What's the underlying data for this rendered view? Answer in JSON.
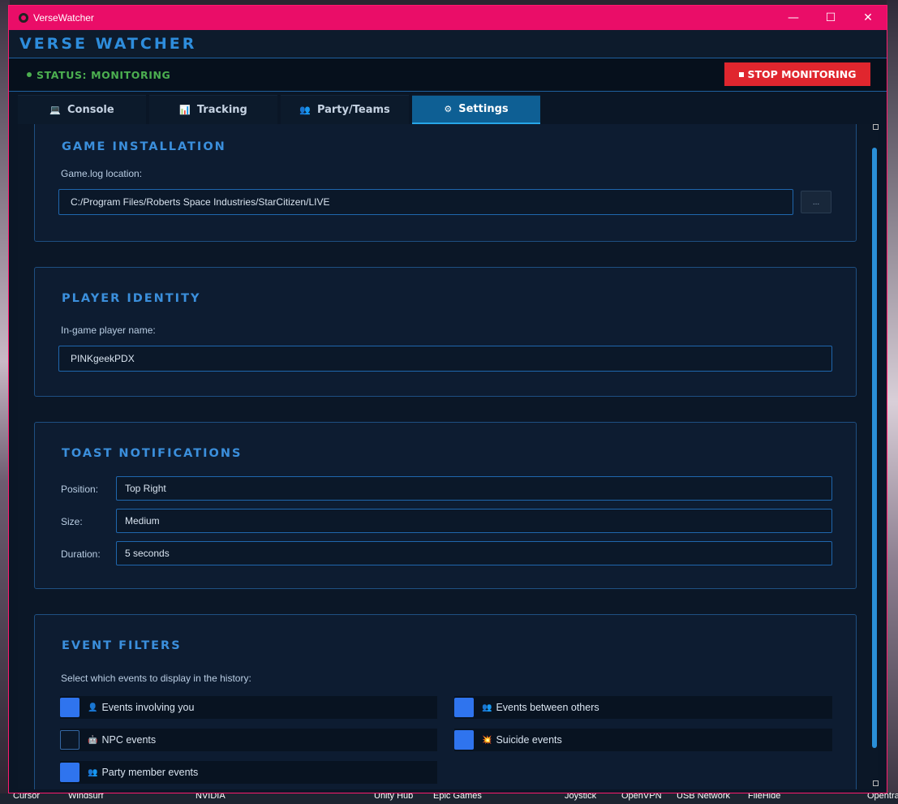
{
  "window": {
    "title": "VerseWatcher"
  },
  "window_controls": {
    "minimize": "—",
    "maximize": "☐",
    "close": "✕"
  },
  "header": {
    "app_title": "VERSE WATCHER"
  },
  "status": {
    "text": "STATUS: MONITORING",
    "color": "#4caf50"
  },
  "stop_button": {
    "label": "STOP MONITORING"
  },
  "tabs": [
    {
      "label": "Console",
      "icon": "laptop-icon",
      "glyph": "💻"
    },
    {
      "label": "Tracking",
      "icon": "chart-icon",
      "glyph": "📊"
    },
    {
      "label": "Party/Teams",
      "icon": "people-icon",
      "glyph": "👥"
    },
    {
      "label": "Settings",
      "icon": "gear-icon",
      "glyph": "⚙"
    }
  ],
  "active_tab": "Settings",
  "game_installation": {
    "title": "GAME INSTALLATION",
    "log_label": "Game.log location:",
    "log_path": "C:/Program Files/Roberts Space Industries/StarCitizen/LIVE",
    "browse_label": "..."
  },
  "player_identity": {
    "title": "PLAYER IDENTITY",
    "name_label": "In-game player name:",
    "name_value": "PINKgeekPDX"
  },
  "toast_notifications": {
    "title": "TOAST NOTIFICATIONS",
    "position_label": "Position:",
    "position_value": "Top Right",
    "size_label": "Size:",
    "size_value": "Medium",
    "duration_label": "Duration:",
    "duration_value": "5 seconds"
  },
  "event_filters": {
    "title": "EVENT FILTERS",
    "description": "Select which events to display in the history:",
    "items": [
      {
        "label": "Events involving you",
        "icon": "person-icon",
        "glyph": "👤",
        "checked": true
      },
      {
        "label": "Events between others",
        "icon": "people-icon",
        "glyph": "👥",
        "checked": true
      },
      {
        "label": "NPC events",
        "icon": "robot-icon",
        "glyph": "🤖",
        "checked": false
      },
      {
        "label": "Suicide events",
        "icon": "collision-icon",
        "glyph": "💥",
        "checked": true
      },
      {
        "label": "Party member events",
        "icon": "people-icon",
        "glyph": "👥",
        "checked": true
      }
    ]
  },
  "taskbar": [
    "Cursor",
    "Windsurf",
    "NVIDIA",
    "Unity Hub",
    "Epic Games",
    "Joystick",
    "OpenVPN",
    "USB Network",
    "FileHide",
    "Opentrack"
  ],
  "colors": {
    "title_bar": "#ea0d68",
    "accent": "#2e8ddc",
    "stop": "#e0262e",
    "checkbox_on": "#2f74ee"
  }
}
